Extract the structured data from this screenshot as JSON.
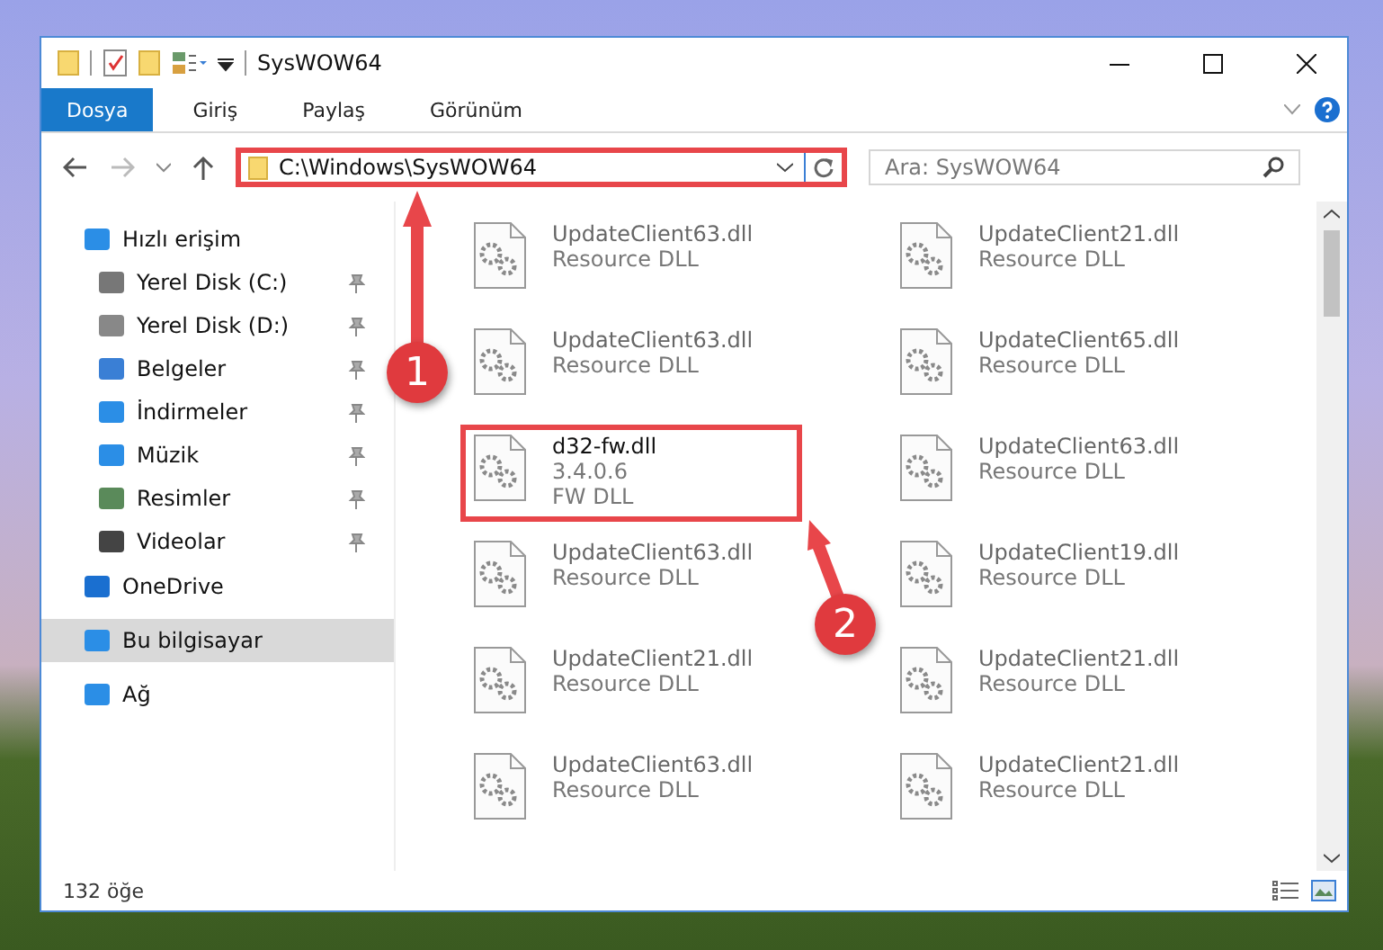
{
  "window": {
    "title": "SysWOW64"
  },
  "ribbon_tabs": [
    {
      "label": "Dosya",
      "selected": true
    },
    {
      "label": "Giriş",
      "selected": false
    },
    {
      "label": "Paylaş",
      "selected": false
    },
    {
      "label": "Görünüm",
      "selected": false
    }
  ],
  "address_bar": {
    "path": "C:\\Windows\\SysWOW64"
  },
  "search": {
    "placeholder": "Ara: SysWOW64"
  },
  "sidebar": {
    "items": [
      {
        "label": "Hızlı erişim",
        "selected": false,
        "children": [
          {
            "label": "Yerel Disk (C:)",
            "pinned": true,
            "selected": false
          },
          {
            "label": "Yerel Disk (D:)",
            "pinned": true,
            "selected": false
          },
          {
            "label": "Belgeler",
            "pinned": true,
            "selected": false
          },
          {
            "label": "İndirmeler",
            "pinned": true,
            "selected": false
          },
          {
            "label": "Müzik",
            "pinned": true,
            "selected": false
          },
          {
            "label": "Resimler",
            "pinned": true,
            "selected": false
          },
          {
            "label": "Videolar",
            "pinned": true,
            "selected": false
          }
        ]
      },
      {
        "label": "OneDrive",
        "selected": false
      },
      {
        "label": "Bu bilgisayar",
        "selected": true
      },
      {
        "label": "Ağ",
        "selected": false
      }
    ]
  },
  "files": [
    {
      "name": "UpdateClient63.dll",
      "lines": [
        "Resource DLL"
      ],
      "highlighted": false
    },
    {
      "name": "UpdateClient21.dll",
      "lines": [
        "Resource DLL"
      ],
      "highlighted": false
    },
    {
      "name": "UpdateClient63.dll",
      "lines": [
        "Resource DLL"
      ],
      "highlighted": false
    },
    {
      "name": "UpdateClient65.dll",
      "lines": [
        "Resource DLL"
      ],
      "highlighted": false
    },
    {
      "name": "d32-fw.dll",
      "lines": [
        "3.4.0.6",
        "FW DLL"
      ],
      "highlighted": true
    },
    {
      "name": "UpdateClient63.dll",
      "lines": [
        "Resource DLL"
      ],
      "highlighted": false
    },
    {
      "name": "UpdateClient63.dll",
      "lines": [
        "Resource DLL"
      ],
      "highlighted": false
    },
    {
      "name": "UpdateClient19.dll",
      "lines": [
        "Resource DLL"
      ],
      "highlighted": false
    },
    {
      "name": "UpdateClient21.dll",
      "lines": [
        "Resource DLL"
      ],
      "highlighted": false
    },
    {
      "name": "UpdateClient21.dll",
      "lines": [
        "Resource DLL"
      ],
      "highlighted": false
    },
    {
      "name": "UpdateClient63.dll",
      "lines": [
        "Resource DLL"
      ],
      "highlighted": false
    },
    {
      "name": "UpdateClient21.dll",
      "lines": [
        "Resource DLL"
      ],
      "highlighted": false
    }
  ],
  "status_bar": {
    "count": "132 öğe"
  },
  "annotations": [
    {
      "label": "1"
    },
    {
      "label": "2"
    }
  ]
}
